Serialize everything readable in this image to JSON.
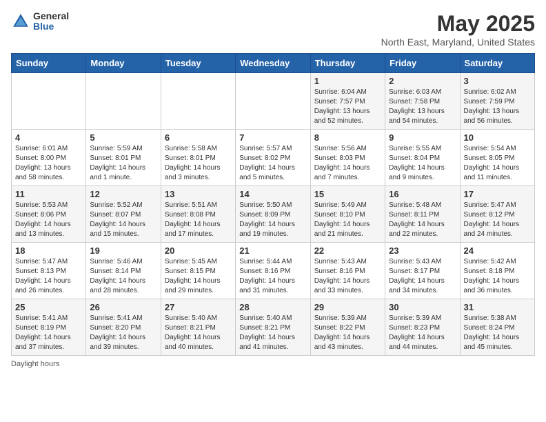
{
  "header": {
    "logo_general": "General",
    "logo_blue": "Blue",
    "month_title": "May 2025",
    "location": "North East, Maryland, United States"
  },
  "days_of_week": [
    "Sunday",
    "Monday",
    "Tuesday",
    "Wednesday",
    "Thursday",
    "Friday",
    "Saturday"
  ],
  "weeks": [
    [
      {
        "day": "",
        "info": ""
      },
      {
        "day": "",
        "info": ""
      },
      {
        "day": "",
        "info": ""
      },
      {
        "day": "",
        "info": ""
      },
      {
        "day": "1",
        "info": "Sunrise: 6:04 AM\nSunset: 7:57 PM\nDaylight: 13 hours\nand 52 minutes."
      },
      {
        "day": "2",
        "info": "Sunrise: 6:03 AM\nSunset: 7:58 PM\nDaylight: 13 hours\nand 54 minutes."
      },
      {
        "day": "3",
        "info": "Sunrise: 6:02 AM\nSunset: 7:59 PM\nDaylight: 13 hours\nand 56 minutes."
      }
    ],
    [
      {
        "day": "4",
        "info": "Sunrise: 6:01 AM\nSunset: 8:00 PM\nDaylight: 13 hours\nand 58 minutes."
      },
      {
        "day": "5",
        "info": "Sunrise: 5:59 AM\nSunset: 8:01 PM\nDaylight: 14 hours\nand 1 minute."
      },
      {
        "day": "6",
        "info": "Sunrise: 5:58 AM\nSunset: 8:01 PM\nDaylight: 14 hours\nand 3 minutes."
      },
      {
        "day": "7",
        "info": "Sunrise: 5:57 AM\nSunset: 8:02 PM\nDaylight: 14 hours\nand 5 minutes."
      },
      {
        "day": "8",
        "info": "Sunrise: 5:56 AM\nSunset: 8:03 PM\nDaylight: 14 hours\nand 7 minutes."
      },
      {
        "day": "9",
        "info": "Sunrise: 5:55 AM\nSunset: 8:04 PM\nDaylight: 14 hours\nand 9 minutes."
      },
      {
        "day": "10",
        "info": "Sunrise: 5:54 AM\nSunset: 8:05 PM\nDaylight: 14 hours\nand 11 minutes."
      }
    ],
    [
      {
        "day": "11",
        "info": "Sunrise: 5:53 AM\nSunset: 8:06 PM\nDaylight: 14 hours\nand 13 minutes."
      },
      {
        "day": "12",
        "info": "Sunrise: 5:52 AM\nSunset: 8:07 PM\nDaylight: 14 hours\nand 15 minutes."
      },
      {
        "day": "13",
        "info": "Sunrise: 5:51 AM\nSunset: 8:08 PM\nDaylight: 14 hours\nand 17 minutes."
      },
      {
        "day": "14",
        "info": "Sunrise: 5:50 AM\nSunset: 8:09 PM\nDaylight: 14 hours\nand 19 minutes."
      },
      {
        "day": "15",
        "info": "Sunrise: 5:49 AM\nSunset: 8:10 PM\nDaylight: 14 hours\nand 21 minutes."
      },
      {
        "day": "16",
        "info": "Sunrise: 5:48 AM\nSunset: 8:11 PM\nDaylight: 14 hours\nand 22 minutes."
      },
      {
        "day": "17",
        "info": "Sunrise: 5:47 AM\nSunset: 8:12 PM\nDaylight: 14 hours\nand 24 minutes."
      }
    ],
    [
      {
        "day": "18",
        "info": "Sunrise: 5:47 AM\nSunset: 8:13 PM\nDaylight: 14 hours\nand 26 minutes."
      },
      {
        "day": "19",
        "info": "Sunrise: 5:46 AM\nSunset: 8:14 PM\nDaylight: 14 hours\nand 28 minutes."
      },
      {
        "day": "20",
        "info": "Sunrise: 5:45 AM\nSunset: 8:15 PM\nDaylight: 14 hours\nand 29 minutes."
      },
      {
        "day": "21",
        "info": "Sunrise: 5:44 AM\nSunset: 8:16 PM\nDaylight: 14 hours\nand 31 minutes."
      },
      {
        "day": "22",
        "info": "Sunrise: 5:43 AM\nSunset: 8:16 PM\nDaylight: 14 hours\nand 33 minutes."
      },
      {
        "day": "23",
        "info": "Sunrise: 5:43 AM\nSunset: 8:17 PM\nDaylight: 14 hours\nand 34 minutes."
      },
      {
        "day": "24",
        "info": "Sunrise: 5:42 AM\nSunset: 8:18 PM\nDaylight: 14 hours\nand 36 minutes."
      }
    ],
    [
      {
        "day": "25",
        "info": "Sunrise: 5:41 AM\nSunset: 8:19 PM\nDaylight: 14 hours\nand 37 minutes."
      },
      {
        "day": "26",
        "info": "Sunrise: 5:41 AM\nSunset: 8:20 PM\nDaylight: 14 hours\nand 39 minutes."
      },
      {
        "day": "27",
        "info": "Sunrise: 5:40 AM\nSunset: 8:21 PM\nDaylight: 14 hours\nand 40 minutes."
      },
      {
        "day": "28",
        "info": "Sunrise: 5:40 AM\nSunset: 8:21 PM\nDaylight: 14 hours\nand 41 minutes."
      },
      {
        "day": "29",
        "info": "Sunrise: 5:39 AM\nSunset: 8:22 PM\nDaylight: 14 hours\nand 43 minutes."
      },
      {
        "day": "30",
        "info": "Sunrise: 5:39 AM\nSunset: 8:23 PM\nDaylight: 14 hours\nand 44 minutes."
      },
      {
        "day": "31",
        "info": "Sunrise: 5:38 AM\nSunset: 8:24 PM\nDaylight: 14 hours\nand 45 minutes."
      }
    ]
  ],
  "footer": {
    "note": "Daylight hours"
  }
}
